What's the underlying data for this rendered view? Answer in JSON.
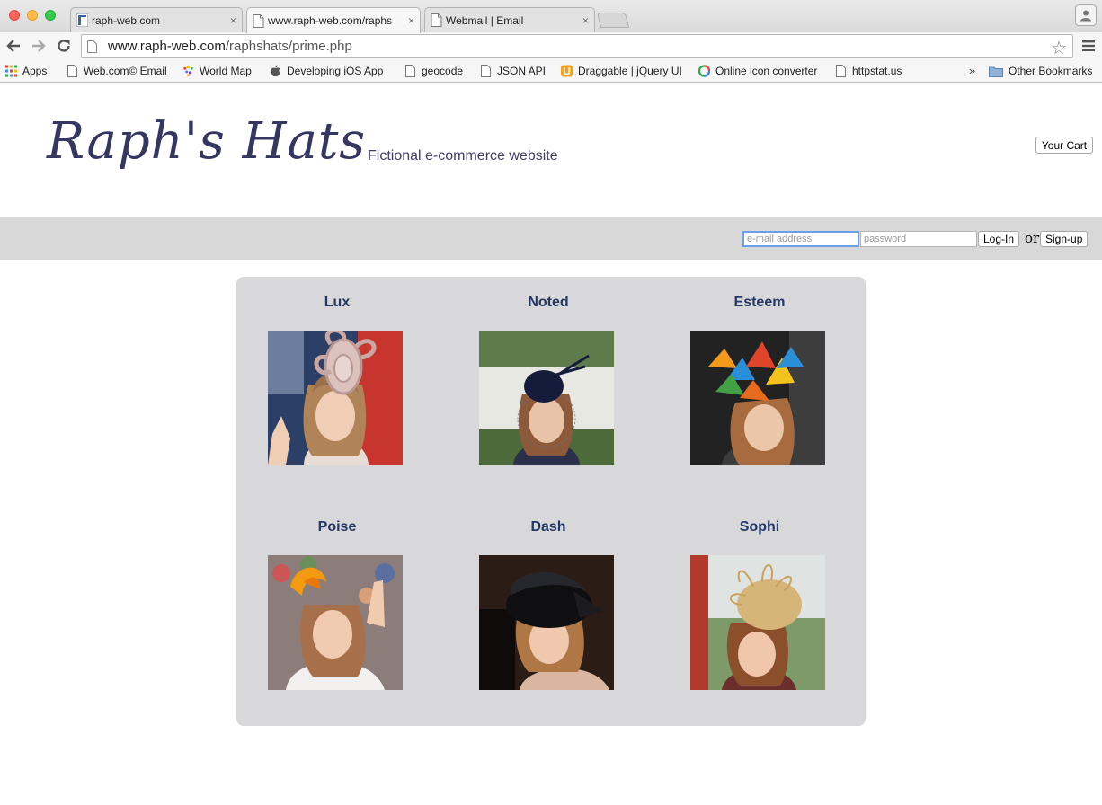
{
  "browser": {
    "tabs": [
      {
        "title": "raph-web.com",
        "close": "×",
        "active": false
      },
      {
        "title": "www.raph-web.com/raphs",
        "close": "×",
        "active": true
      },
      {
        "title": "Webmail | Email",
        "close": "×",
        "active": false
      }
    ],
    "address": {
      "host": "www.raph-web.com",
      "path": "/raphshats/prime.php"
    },
    "bookmarks": [
      {
        "label": "Apps",
        "icon": "apps-grid-icon"
      },
      {
        "label": "Web.com© Email",
        "icon": "page-icon"
      },
      {
        "label": "World Map",
        "icon": "world-map-icon"
      },
      {
        "label": "Developing iOS App",
        "icon": "apple-icon"
      },
      {
        "label": "geocode",
        "icon": "page-icon"
      },
      {
        "label": "JSON API",
        "icon": "page-icon"
      },
      {
        "label": "Draggable | jQuery UI",
        "icon": "jquery-ui-icon"
      },
      {
        "label": "Online icon converter",
        "icon": "converter-icon"
      },
      {
        "label": "httpstat.us",
        "icon": "page-icon"
      }
    ],
    "bookmarks_overflow": "»",
    "other_bookmarks": "Other Bookmarks"
  },
  "site": {
    "logo": "Raph's Hats",
    "tagline": "Fictional e-commerce website",
    "cart_label": "Your Cart",
    "login": {
      "email_placeholder": "e-mail address",
      "password_placeholder": "password",
      "login_label": "Log-In",
      "or_text": "or",
      "signup_label": "Sign-up"
    }
  },
  "products": [
    {
      "name": "Lux",
      "hat": "pink looped fascinator"
    },
    {
      "name": "Noted",
      "hat": "navy veiled fascinator"
    },
    {
      "name": "Esteem",
      "hat": "butterfly fascinator"
    },
    {
      "name": "Poise",
      "hat": "orange swirl fascinator"
    },
    {
      "name": "Dash",
      "hat": "black satin cap"
    },
    {
      "name": "Sophi",
      "hat": "gold feathered disc"
    }
  ]
}
